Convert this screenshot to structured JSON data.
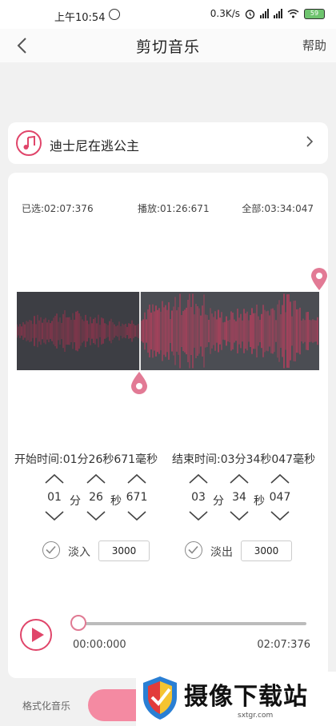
{
  "status_bar": {
    "time": "上午10:54",
    "speed": "0.3K/s",
    "battery": "59"
  },
  "nav": {
    "title": "剪切音乐",
    "help": "帮助"
  },
  "song": {
    "name": "迪士尼在逃公主"
  },
  "times": {
    "selected": "已选:02:07:376",
    "playing": "播放:01:26:671",
    "total": "全部:03:34:047"
  },
  "range": {
    "start_label": "开始时间:01分26秒671毫秒",
    "end_label": "结束时间:03分34秒047毫秒",
    "start": {
      "min": "01",
      "sec": "26",
      "ms": "671"
    },
    "end": {
      "min": "03",
      "sec": "34",
      "ms": "047"
    },
    "unit_min": "分",
    "unit_sec": "秒"
  },
  "fade": {
    "in_label": "淡入",
    "in_value": "3000",
    "out_label": "淡出",
    "out_value": "3000"
  },
  "player": {
    "current": "00:00:000",
    "duration": "02:07:376",
    "progress": 0
  },
  "bottom": {
    "format_label": "格式化音乐"
  },
  "watermark": {
    "brand": "摄像下载站",
    "url": "sxtgr.com"
  },
  "colors": {
    "accent": "#e0456a",
    "wave": "#e23a62",
    "wave_bg": "#4b4d53",
    "button": "#f48aa2"
  }
}
